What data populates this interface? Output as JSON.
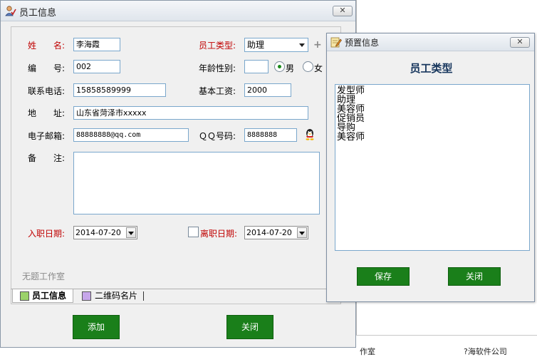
{
  "background": {
    "status_fragments": [
      "作室",
      "?海软件公司"
    ]
  },
  "main_window": {
    "title": "员工信息",
    "close_glyph": "✕",
    "form": {
      "name_label": "姓　　名:",
      "name_value": "李海霞",
      "employee_type_label": "员工类型:",
      "employee_type_value": "助理",
      "id_label": "编　　号:",
      "id_value": "002",
      "age_gender_label": "年龄性别:",
      "age_value": "",
      "gender_options": [
        "男",
        "女"
      ],
      "gender_selected": "男",
      "phone_label": "联系电话:",
      "phone_value": "15858589999",
      "salary_label": "基本工资:",
      "salary_value": "2000",
      "address_label": "地　　址:",
      "address_value": "山东省菏泽市xxxxx",
      "email_label": "电子邮箱:",
      "email_value": "88888888@qq.com",
      "qq_label": "ＱＱ号码:",
      "qq_value": "8888888",
      "remark_label": "备　　注:",
      "remark_value": "",
      "hire_date_label": "入职日期:",
      "hire_date_value": "2014-07-20",
      "leave_date_label": "离职日期:",
      "leave_date_value": "2014-07-20",
      "leave_date_checked": false
    },
    "studio_text": "无题工作室",
    "tabs": [
      {
        "label": "员工信息",
        "swatch": "#9bd26a"
      },
      {
        "label": "二维码名片",
        "swatch": "#c6a6ea"
      }
    ],
    "buttons": {
      "add": "添加",
      "close": "关闭"
    }
  },
  "popup_window": {
    "title": "预置信息",
    "heading": "员工类型",
    "list_items": [
      "发型师",
      "助理",
      "美容师",
      "促销员",
      "导购",
      "美容师"
    ],
    "buttons": {
      "save": "保存",
      "close": "关闭"
    }
  },
  "colors": {
    "button_green": "#1a7f1a",
    "label_red": "#c00000",
    "heading_navy": "#17365d",
    "field_border": "#7aa7cc"
  }
}
